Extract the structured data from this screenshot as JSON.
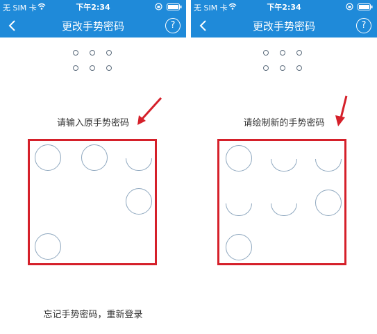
{
  "colors": {
    "accent": "#1f8ad9",
    "highlight": "#d5202a",
    "node": "#8fa8bf"
  },
  "status_bar": {
    "carrier": "无 SIM 卡",
    "time": "下午2:34"
  },
  "header": {
    "title": "更改手势密码",
    "help_label": "?"
  },
  "left_screen": {
    "hint": "请输入原手势密码",
    "forgot_link": "忘记手势密码，重新登录",
    "nodes": [
      "circle",
      "circle",
      "arc",
      "empty",
      "empty",
      "circle",
      "circle",
      "empty",
      "empty"
    ]
  },
  "right_screen": {
    "hint": "请绘制新的手势密码",
    "nodes": [
      "circle",
      "arc",
      "arc",
      "arc",
      "arc",
      "circle",
      "circle",
      "empty",
      "empty"
    ]
  }
}
